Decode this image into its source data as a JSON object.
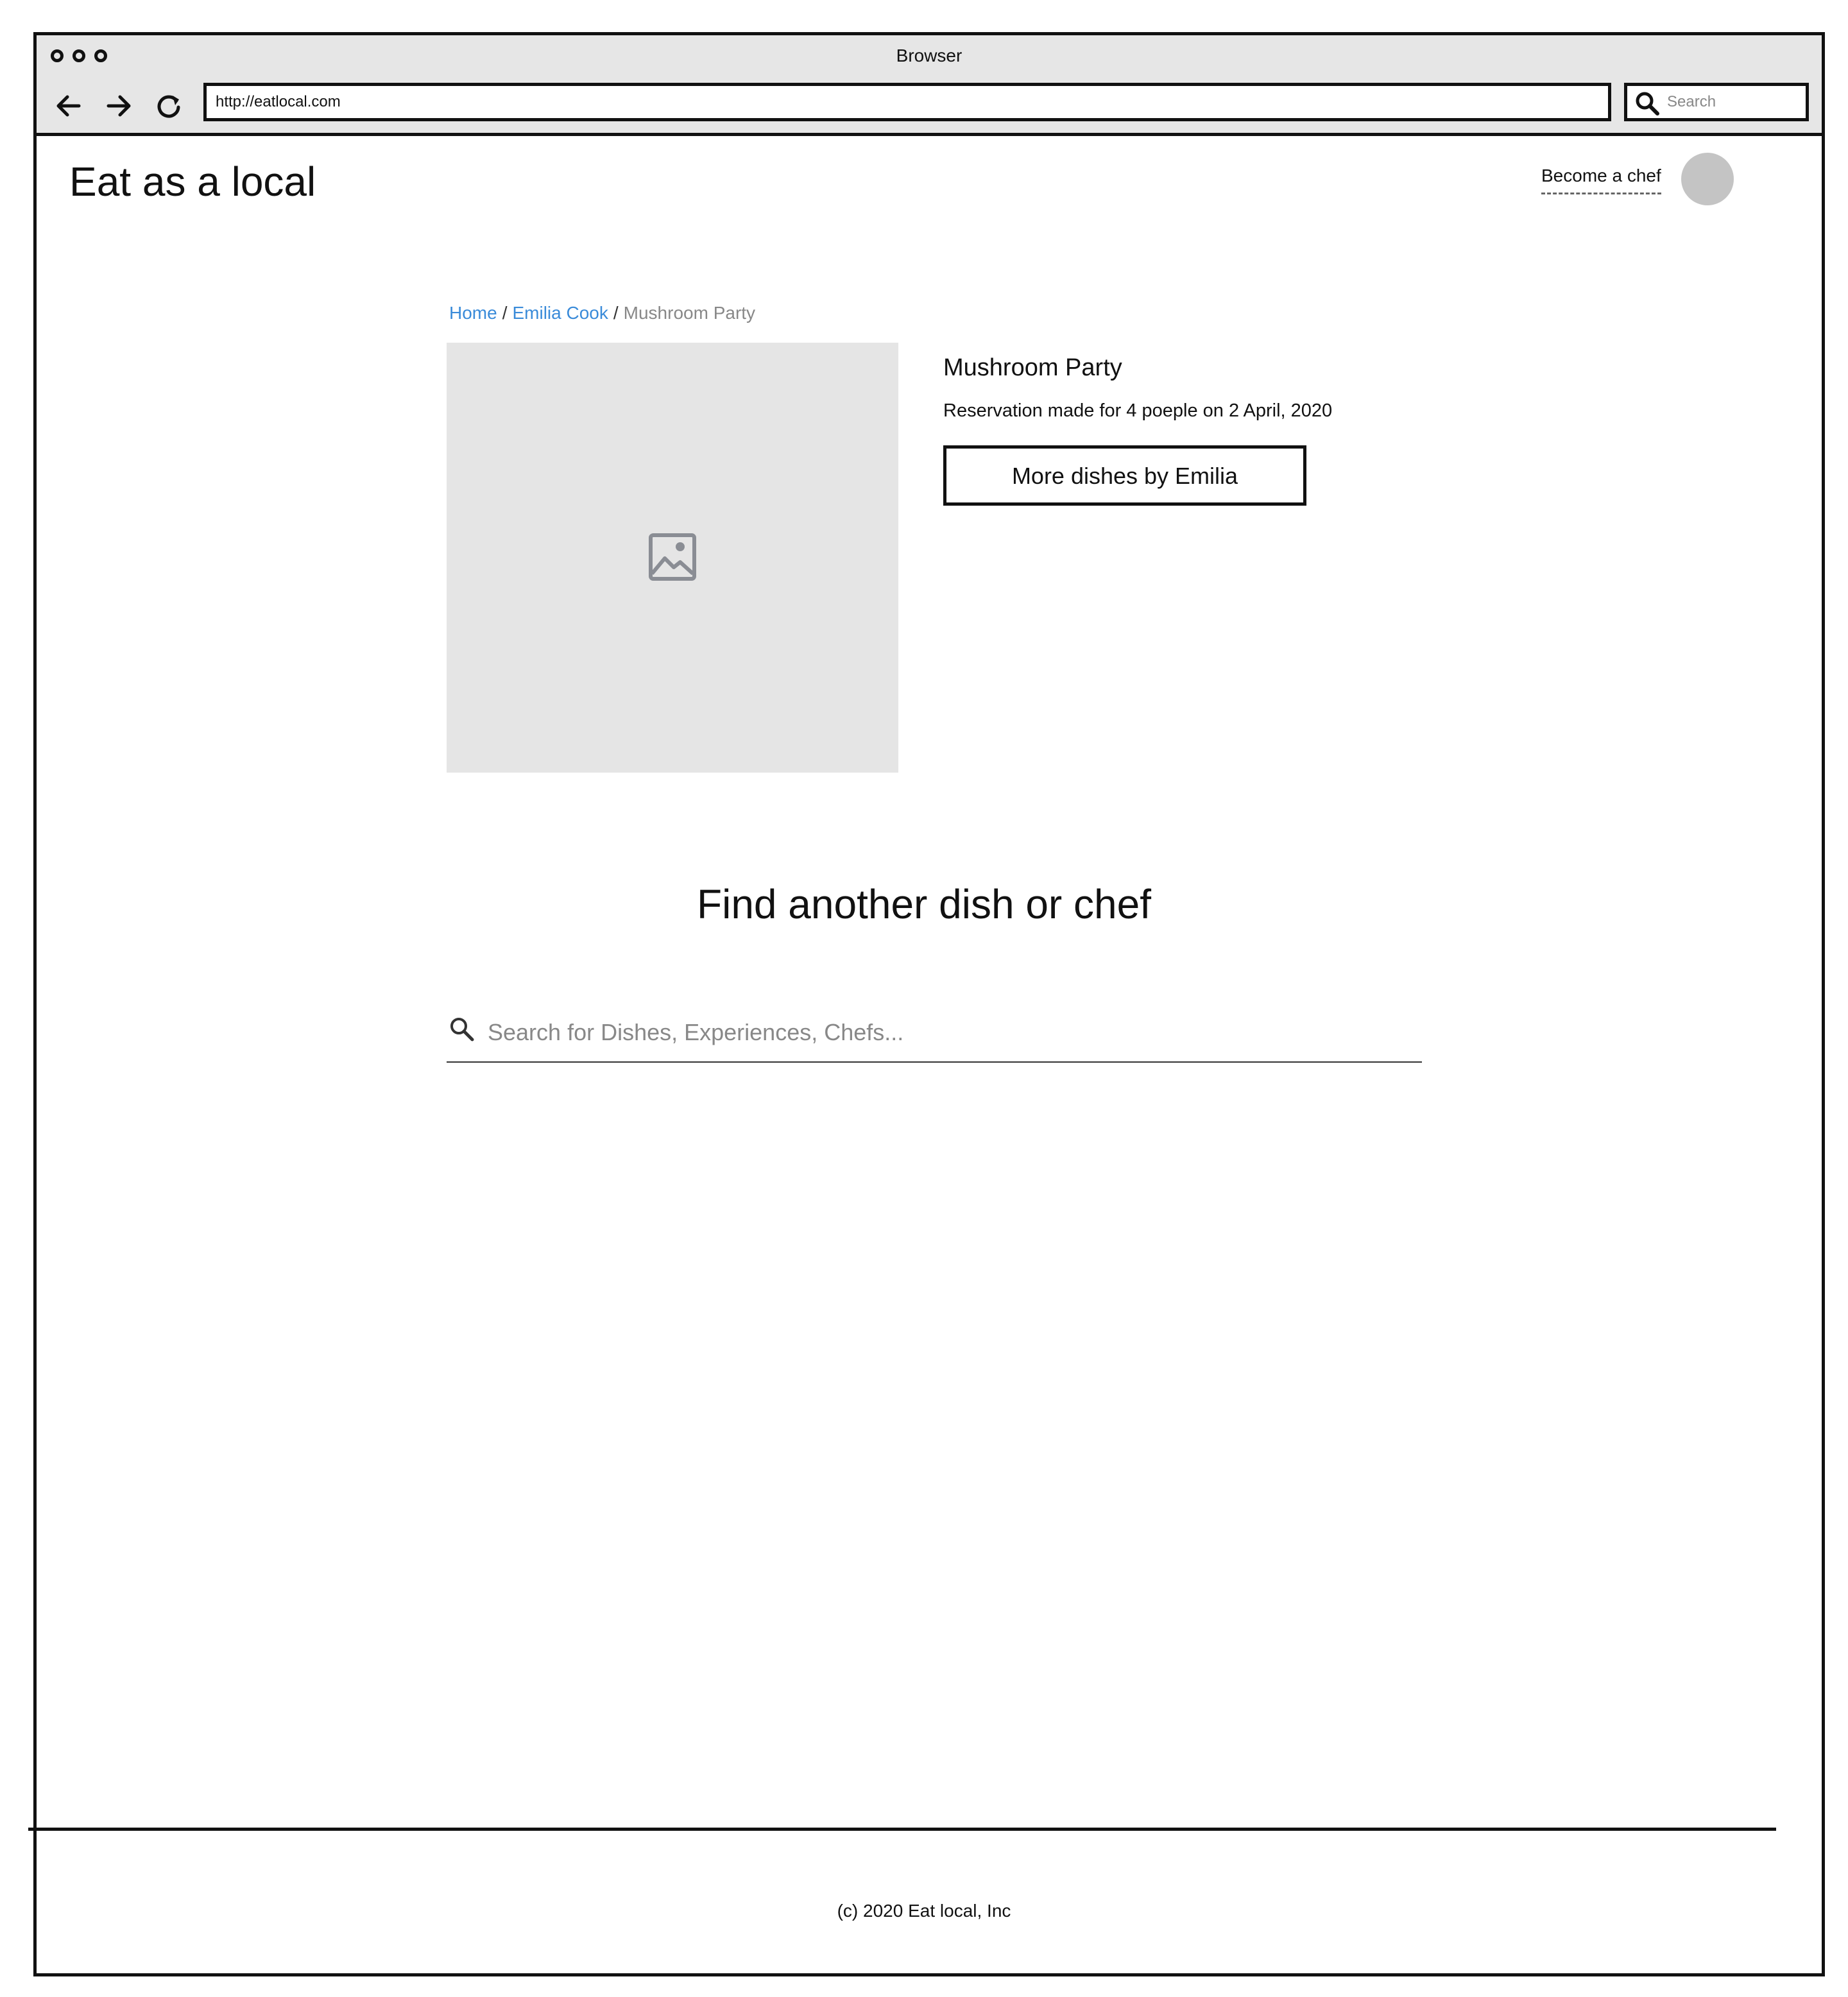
{
  "browser": {
    "title": "Browser",
    "url": "http://eatlocal.com",
    "search_placeholder": "Search"
  },
  "header": {
    "logo": "Eat as a local",
    "become_chef": "Become a chef"
  },
  "breadcrumb": {
    "home": "Home",
    "chef": "Emilia Cook",
    "current": "Mushroom Party",
    "separator": "/"
  },
  "dish": {
    "title": "Mushroom Party",
    "reservation": "Reservation made for 4 poeple on 2 April, 2020",
    "more_button": "More dishes by Emilia"
  },
  "find": {
    "heading": "Find another dish or chef",
    "search_placeholder": "Search for Dishes, Experiences, Chefs..."
  },
  "footer": {
    "text": "(c) 2020 Eat local, Inc"
  },
  "colors": {
    "link": "#3a8bd9",
    "chrome": "#e6e6e6",
    "placeholder_image": "#e5e5e5",
    "avatar": "#c4c4c4"
  }
}
